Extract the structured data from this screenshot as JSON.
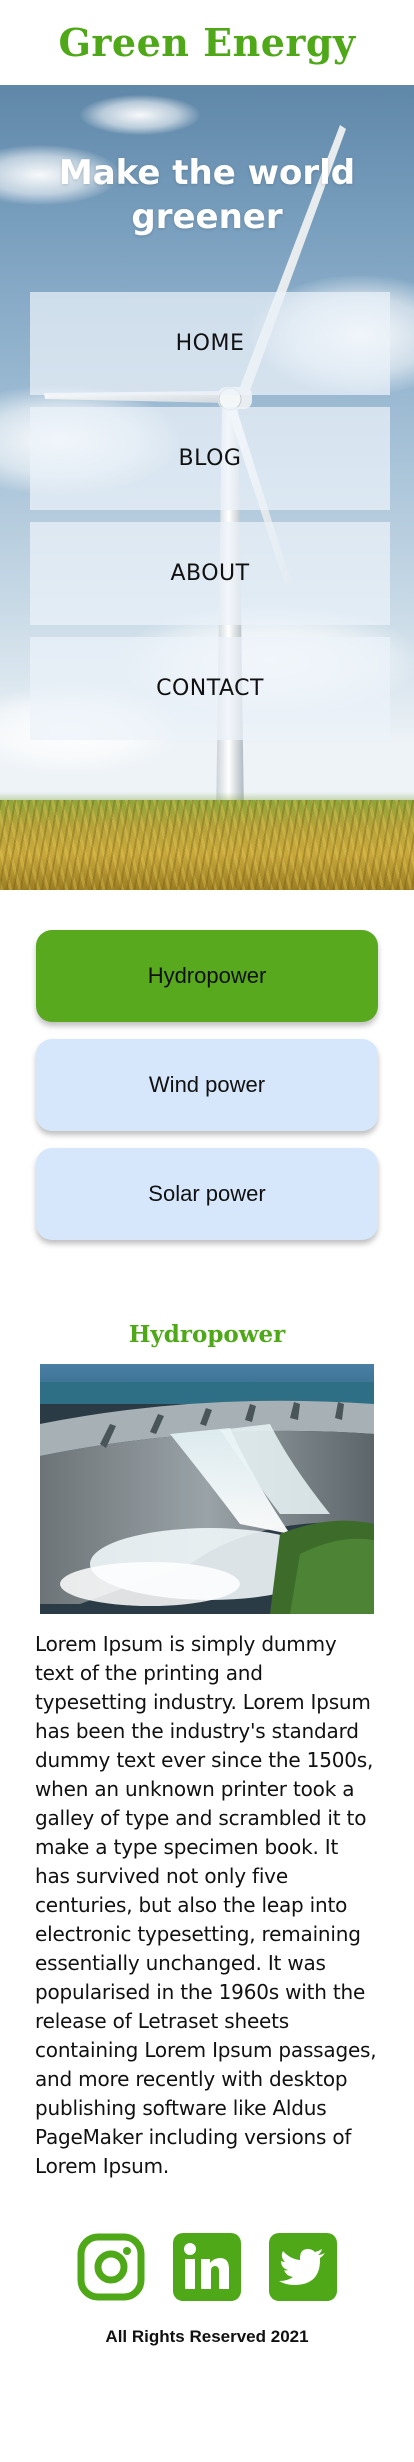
{
  "header": {
    "brand": "Green Energy"
  },
  "hero": {
    "title": "Make the world greener",
    "nav": [
      {
        "label": "HOME"
      },
      {
        "label": "BLOG"
      },
      {
        "label": "ABOUT"
      },
      {
        "label": "CONTACT"
      }
    ]
  },
  "tabs": {
    "items": [
      {
        "label": "Hydropower",
        "active": true
      },
      {
        "label": "Wind power",
        "active": false
      },
      {
        "label": "Solar power",
        "active": false
      }
    ]
  },
  "content": {
    "title": "Hydropower",
    "body": "Lorem Ipsum is simply dummy text of the printing and typesetting industry. Lorem Ipsum has been the industry's standard dummy text ever since the 1500s, when an unknown printer took a galley of type and scrambled it to make a type specimen book. It has survived not only five centuries, but also the leap into electronic typesetting, remaining essentially unchanged. It was popularised in the 1960s with the release of Letraset sheets containing Lorem Ipsum passages, and more recently with desktop publishing software like Aldus PageMaker including versions of Lorem Ipsum."
  },
  "footer": {
    "social": [
      {
        "icon": "instagram-icon"
      },
      {
        "icon": "linkedin-icon"
      },
      {
        "icon": "twitter-icon"
      }
    ],
    "copyright": "All Rights Reserved 2021"
  },
  "colors": {
    "brand_green": "#4fa818",
    "active_tab": "#58a91d",
    "inactive_tab": "#d6e7fb"
  }
}
